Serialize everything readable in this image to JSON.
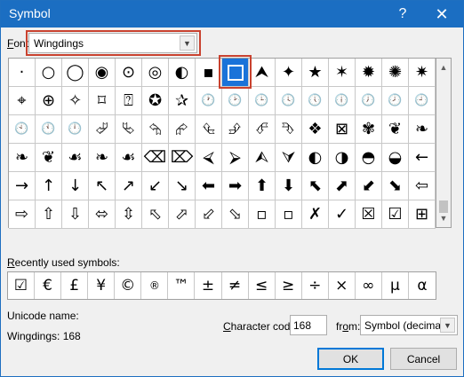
{
  "window": {
    "title": "Symbol",
    "help_glyph": "?",
    "close_glyph": "✕"
  },
  "font": {
    "label_accel": "F",
    "label_rest": "ont:",
    "value": "Wingdings",
    "arrow": "▼"
  },
  "grid_symbols": [
    [
      "·",
      "○",
      "◯",
      "◉",
      "⊙",
      "◎",
      "◐",
      "▪",
      "□",
      "⮝",
      "✦",
      "★",
      "✶",
      "✹",
      "✺",
      "✷"
    ],
    [
      "⌖",
      "⊕",
      "✧",
      "⌑",
      "⍰",
      "✪",
      "✰",
      "🕐",
      "🕑",
      "🕒",
      "🕓",
      "🕔",
      "🕕",
      "🕖",
      "🕗",
      "🕘"
    ],
    [
      "🕙",
      "🕚",
      "🕛",
      "⮰",
      "⮱",
      "⮲",
      "⮳",
      "⮴",
      "⮵",
      "⮶",
      "⮷",
      "❖",
      "⊠",
      "✾",
      "❦",
      "❧"
    ],
    [
      "❧",
      "❦",
      "☙",
      "❧",
      "☙",
      "⌫",
      "⌦",
      "⮘",
      "⮚",
      "⮙",
      "⮛",
      "◐",
      "◑",
      "◓",
      "◒",
      "←"
    ],
    [
      "→",
      "↑",
      "↓",
      "↖",
      "↗",
      "↙",
      "↘",
      "⬅",
      "➡",
      "⬆",
      "⬇",
      "⬉",
      "⬈",
      "⬋",
      "⬊",
      "⇦"
    ],
    [
      "⇨",
      "⇧",
      "⇩",
      "⬄",
      "⇳",
      "⬁",
      "⬀",
      "⬃",
      "⬂",
      "▫",
      "▫",
      "✗",
      "✓",
      "☒",
      "☑",
      "⊞"
    ]
  ],
  "recent": {
    "label_accel": "R",
    "label_rest": "ecently used symbols:",
    "symbols": [
      "☑",
      "€",
      "£",
      "¥",
      "©",
      "®",
      "™",
      "±",
      "≠",
      "≤",
      "≥",
      "÷",
      "×",
      "∞",
      "µ",
      "α"
    ]
  },
  "unicode_name_label": "Unicode name:",
  "unicode_name_value": "Wingdings: 168",
  "character_code": {
    "label_accel": "C",
    "label_rest": "haracter code:",
    "value": "168"
  },
  "from": {
    "label_pre": "fr",
    "label_accel": "o",
    "label_post": "m:",
    "value": "Symbol (decimal)",
    "arrow": "▼"
  },
  "buttons": {
    "ok": "OK",
    "cancel": "Cancel"
  },
  "scrollbar": {
    "up": "▲",
    "down": "▼"
  }
}
